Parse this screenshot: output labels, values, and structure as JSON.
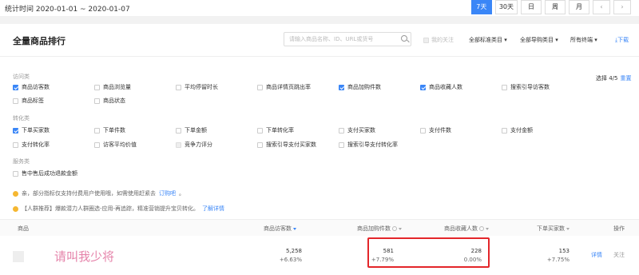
{
  "topbar": {
    "date_range": "统计时间 2020-01-01 ~ 2020-01-07",
    "buttons": [
      {
        "label": "7天",
        "active": true
      },
      {
        "label": "30天",
        "active": false
      },
      {
        "label": "日",
        "active": false
      },
      {
        "label": "周",
        "active": false
      },
      {
        "label": "月",
        "active": false
      }
    ],
    "prev_icon": "chevron-left-icon",
    "next_icon": "chevron-right-icon"
  },
  "panel": {
    "title": "全量商品排行",
    "search_placeholder": "请输入商品名称、ID、URL或货号",
    "followed_label": "我的关注",
    "filters": [
      "全部标准类目",
      "全部导购类目",
      "所有终端"
    ],
    "download_label": "下载"
  },
  "metric_groups": {
    "visit": {
      "label": "访问类",
      "items": [
        {
          "label": "商品访客数",
          "checked": true
        },
        {
          "label": "商品浏览量",
          "checked": false
        },
        {
          "label": "平均停留时长",
          "checked": false
        },
        {
          "label": "商品详情页跳出率",
          "checked": false
        },
        {
          "label": "商品加购件数",
          "checked": true
        },
        {
          "label": "商品收藏人数",
          "checked": true
        },
        {
          "label": "搜索引导访客数",
          "checked": false
        },
        {
          "label": "商品标签",
          "checked": false
        },
        {
          "label": "商品状态",
          "checked": false
        }
      ]
    },
    "conversion": {
      "label": "转化类",
      "items": [
        {
          "label": "下单买家数",
          "checked": true
        },
        {
          "label": "下单件数",
          "checked": false
        },
        {
          "label": "下单金额",
          "checked": false
        },
        {
          "label": "下单转化率",
          "checked": false
        },
        {
          "label": "支付买家数",
          "checked": false
        },
        {
          "label": "支付件数",
          "checked": false
        },
        {
          "label": "支付金额",
          "checked": false
        },
        {
          "label": "支付转化率",
          "checked": false
        },
        {
          "label": "访客平均价值",
          "checked": false
        },
        {
          "label": "竞争力评分",
          "checked": false,
          "disabled": true
        },
        {
          "label": "搜索引导支付买家数",
          "checked": false
        },
        {
          "label": "搜索引导支付转化率",
          "checked": false
        }
      ]
    },
    "service": {
      "label": "服务类",
      "items": [
        {
          "label": "售中售后成功退款金额",
          "checked": false
        }
      ]
    }
  },
  "selection": {
    "text": "选择 4/5",
    "reset_label": "重置"
  },
  "notices": [
    {
      "text": "亲，部分指标仅支持付费用户使用哦，如需使用赶紧去",
      "link": "订购吧",
      "suffix": "。"
    },
    {
      "text": "【人群推荐】爆款潜力人群圈选-应用-再追踪，精准营销提升宝贝转化。",
      "link": "了解详情",
      "suffix": ""
    }
  ],
  "table": {
    "headers": [
      "商品",
      "商品访客数",
      "商品加购件数",
      "商品收藏人数",
      "下单买家数",
      "操作"
    ],
    "rows": [
      {
        "product_name": "请叫我少将",
        "visitors": {
          "value": "5,258",
          "change": "+6.63%"
        },
        "cart_adds": {
          "value": "581",
          "change": "+7.79%"
        },
        "favorites": {
          "value": "228",
          "change": "0.00%"
        },
        "buyers": {
          "value": "153",
          "change": "+7.75%"
        },
        "actions": [
          "详情",
          "关注"
        ]
      }
    ]
  },
  "colors": {
    "accent": "#3a86f7",
    "highlight": "#e3262a",
    "warning": "#f5b731"
  }
}
